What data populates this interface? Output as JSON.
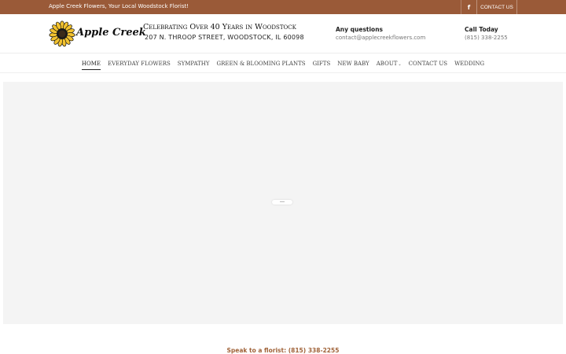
{
  "topbar": {
    "tagline": "Apple Creek Flowers, Your Local Woodstock Florist!",
    "facebook_icon": "facebook-icon",
    "contact_label": "CONTACT US"
  },
  "header": {
    "logo_text": "Apple Creek",
    "celebrate": "Celebrating Over 40 Years in Woodstock",
    "address": "207 N. THROOP STREET, WOODSTOCK, IL 60098",
    "questions_title": "Any questions",
    "questions_email": "contact@applecreekflowers.com",
    "call_title": "Call Today",
    "call_phone": "(815) 338-2255"
  },
  "nav": {
    "items": [
      {
        "label": "HOME"
      },
      {
        "label": "EVERYDAY FLOWERS"
      },
      {
        "label": "SYMPATHY"
      },
      {
        "label": "GREEN & BLOOMING PLANTS"
      },
      {
        "label": "GIFTS"
      },
      {
        "label": "NEW BABY"
      },
      {
        "label": "ABOUT"
      },
      {
        "label": "CONTACT US"
      },
      {
        "label": "WEDDING"
      }
    ]
  },
  "footer": {
    "speak": "Speak to a florist: (815) 338-2255"
  },
  "colors": {
    "topbar": "#9a5a38",
    "accent": "#a06238",
    "hero_bg": "#f4f4f4"
  }
}
